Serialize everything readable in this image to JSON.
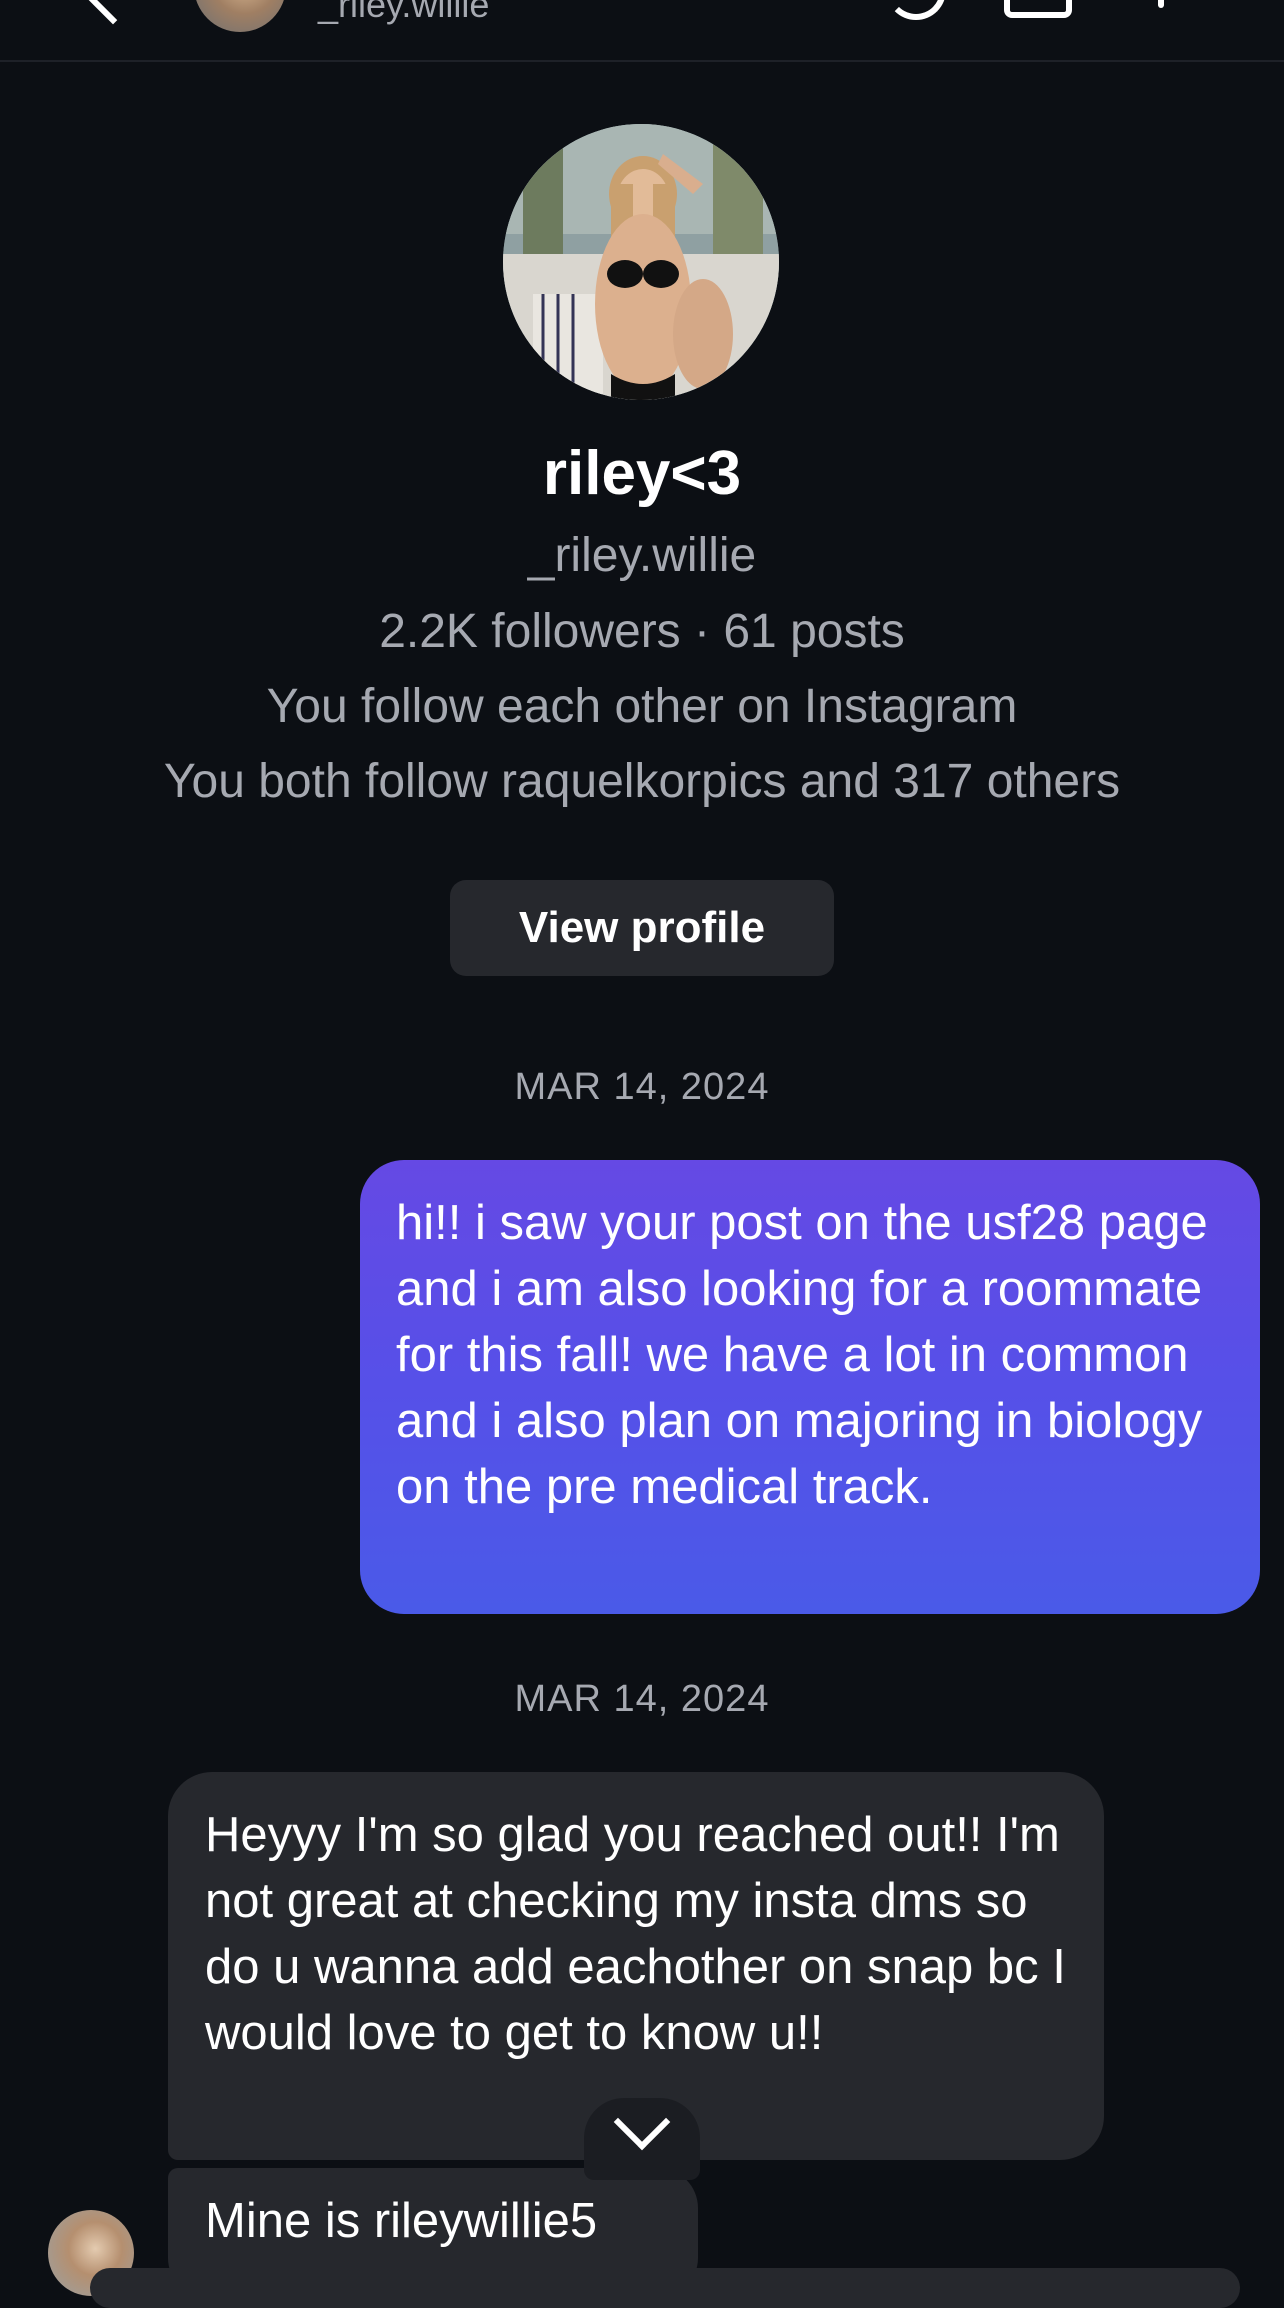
{
  "header": {
    "username": "_riley.willie"
  },
  "profile": {
    "display_name": "riley<3",
    "handle": "_riley.willie",
    "stats": "2.2K followers · 61 posts",
    "mutual_follow": "You follow each other on Instagram",
    "mutual_friends": "You both follow raquelkorpics and 317 others",
    "view_profile_label": "View profile"
  },
  "thread": {
    "date_1": "MAR 14, 2024",
    "date_2": "MAR 14, 2024",
    "outgoing_message": "hi!! i saw your post on the usf28 page and i am also looking for a roommate for this fall! we have a lot in common and i also plan on majoring in biology on the pre medical track.",
    "incoming_message_1": "Heyyy I'm so glad you reached out!! I'm not great at checking my insta dms so do u wanna add eachother on snap bc I would love to get to know u!!",
    "incoming_message_2": "Mine is rileywillie5"
  },
  "colors": {
    "background": "#0c0f14",
    "outgoing_bubble_top": "#6549e4",
    "outgoing_bubble_bottom": "#4a5ae8",
    "incoming_bubble": "#26282d",
    "secondary_text": "#a6a9b1"
  },
  "icons": [
    "back-icon",
    "call-icon",
    "video-icon",
    "flag-icon",
    "chevron-down-icon"
  ]
}
